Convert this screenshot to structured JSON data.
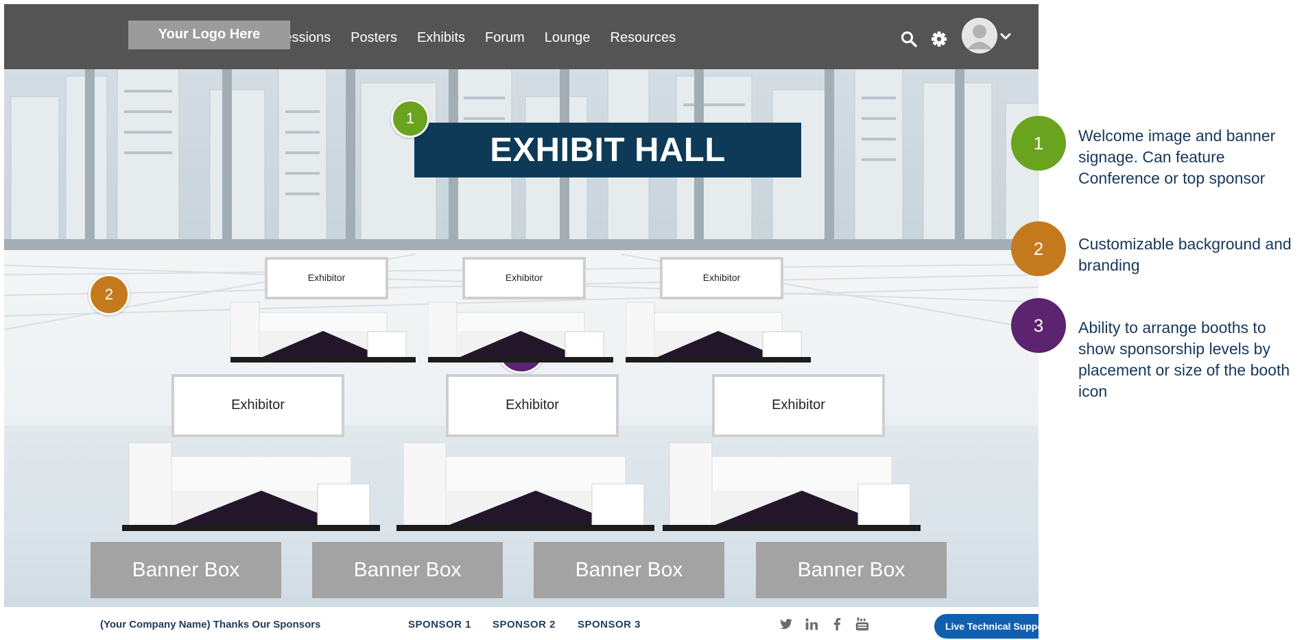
{
  "logo": {
    "text": "Your Logo Here"
  },
  "nav": {
    "items": [
      {
        "label": "Sessions"
      },
      {
        "label": "Posters"
      },
      {
        "label": "Exhibits"
      },
      {
        "label": "Forum"
      },
      {
        "label": "Lounge"
      },
      {
        "label": "Resources"
      }
    ],
    "icons": [
      "search-icon",
      "gear-icon",
      "avatar",
      "chevron-down-icon"
    ]
  },
  "hall": {
    "banner_title": "EXHIBIT HALL",
    "markers": [
      "1",
      "2",
      "3"
    ],
    "booths_top": [
      "Exhibitor",
      "Exhibitor",
      "Exhibitor"
    ],
    "booths_bottom": [
      "Exhibitor",
      "Exhibitor",
      "Exhibitor"
    ],
    "banner_boxes": [
      "Banner Box",
      "Banner Box",
      "Banner Box",
      "Banner Box"
    ]
  },
  "footer": {
    "thanks": "(Your Company Name) Thanks Our Sponsors",
    "sponsors": [
      "SPONSOR 1",
      "SPONSOR 2",
      "SPONSOR 3"
    ],
    "social_icons": [
      "twitter-icon",
      "linkedin-icon",
      "facebook-icon",
      "youtube-icon"
    ],
    "live_support": "Live Technical Support"
  },
  "legend": [
    {
      "number": "1",
      "text": "Welcome image and banner signage. Can feature Conference or top sponsor",
      "color": "#6aa31e"
    },
    {
      "number": "2",
      "text": "Customizable background and branding",
      "color": "#c47a1c"
    },
    {
      "number": "3",
      "text": "Ability to arrange booths to show sponsorship levels by placement or size of the booth icon",
      "color": "#5c2370"
    }
  ],
  "colors": {
    "nav_bg": "#545454",
    "banner_navy": "#0e3a58",
    "banner_box_gray": "#a3a3a3",
    "legend_text": "#16375a",
    "support_blue": "#1160b0"
  }
}
